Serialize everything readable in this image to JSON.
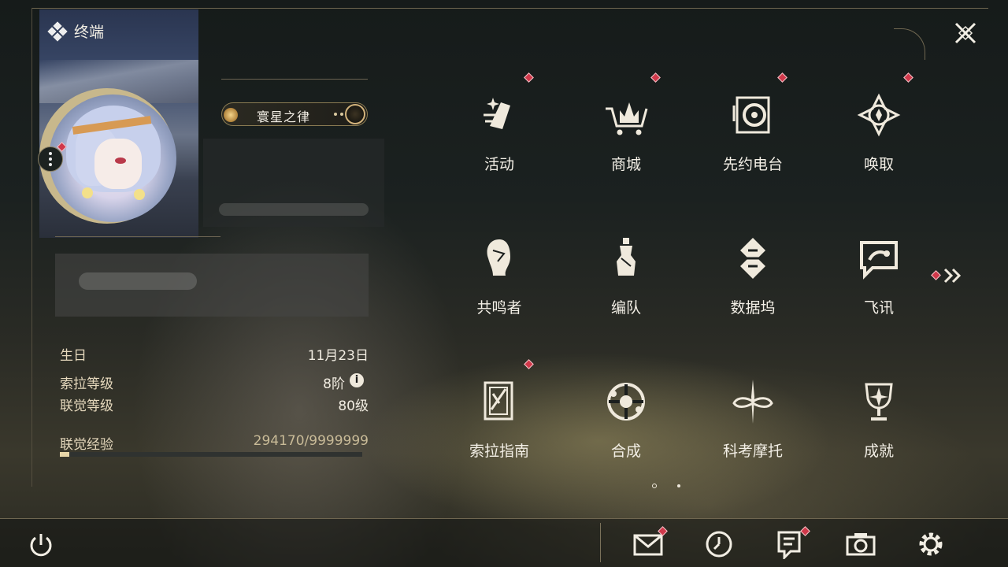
{
  "terminal": {
    "title": "终端"
  },
  "badge": {
    "name": "寰星之律"
  },
  "profile": {
    "rows": [
      {
        "label": "生日",
        "value": "11月23日"
      },
      {
        "label": "索拉等级",
        "value": "8阶"
      },
      {
        "label": "联觉等级",
        "value": "80级"
      },
      {
        "label": "联觉经验",
        "value": "294170/9999999"
      }
    ],
    "exp_progress": 0.0294
  },
  "grid": [
    {
      "label": "活动",
      "icon": "event-icon",
      "alert": true
    },
    {
      "label": "商城",
      "icon": "shop-icon",
      "alert": true
    },
    {
      "label": "先约电台",
      "icon": "radio-icon",
      "alert": true
    },
    {
      "label": "唤取",
      "icon": "gacha-icon",
      "alert": true
    },
    {
      "label": "共鸣者",
      "icon": "resonator-icon",
      "alert": false
    },
    {
      "label": "编队",
      "icon": "team-icon",
      "alert": false
    },
    {
      "label": "数据坞",
      "icon": "data-bank-icon",
      "alert": false
    },
    {
      "label": "飞讯",
      "icon": "chat-icon",
      "alert": false
    },
    {
      "label": "索拉指南",
      "icon": "guidebook-icon",
      "alert": true
    },
    {
      "label": "合成",
      "icon": "synthesis-icon",
      "alert": false
    },
    {
      "label": "科考摩托",
      "icon": "motorcycle-icon",
      "alert": false
    },
    {
      "label": "成就",
      "icon": "trophy-icon",
      "alert": false
    }
  ],
  "pagination": {
    "current": 1,
    "total": 2
  },
  "bottom_bar": [
    "mail-icon",
    "clock-icon",
    "notice-icon",
    "camera-icon",
    "settings-icon"
  ],
  "colors": {
    "accent": "#e8d6a8",
    "alert": "#d0384a"
  }
}
